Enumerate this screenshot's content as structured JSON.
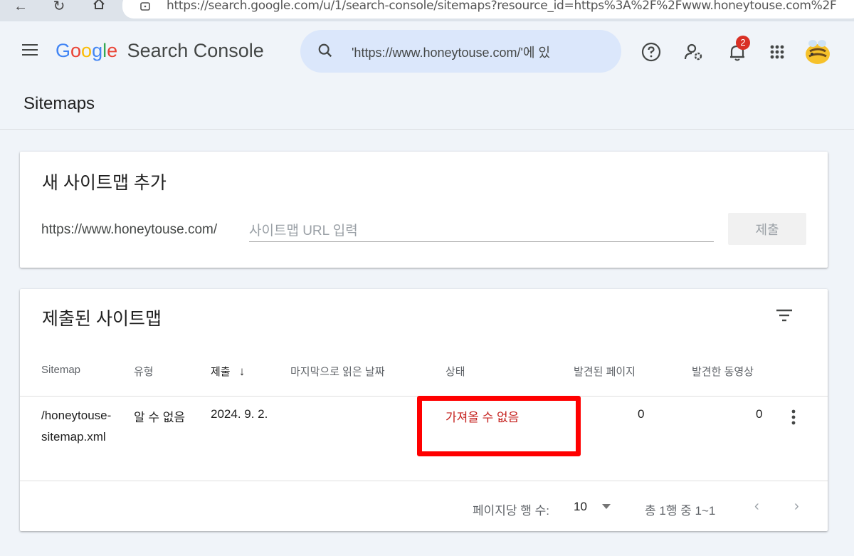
{
  "browser": {
    "url": "https://search.google.com/u/1/search-console/sitemaps?resource_id=https%3A%2F%2Fwww.honeytouse.com%2F"
  },
  "header": {
    "logo_letters": [
      "G",
      "o",
      "o",
      "g",
      "l",
      "e"
    ],
    "product_name": "Search Console",
    "search_value": "'https://www.honeytouse.com/'에 있",
    "notification_count": "2"
  },
  "page": {
    "title": "Sitemaps"
  },
  "add_sitemap": {
    "title": "새 사이트맵 추가",
    "url_prefix": "https://www.honeytouse.com/",
    "input_placeholder": "사이트맵 URL 입력",
    "submit_label": "제출"
  },
  "submitted": {
    "title": "제출된 사이트맵",
    "columns": [
      "Sitemap",
      "유형",
      "제출",
      "마지막으로 읽은 날짜",
      "상태",
      "발견된 페이지",
      "발견한 동영상"
    ],
    "sort_indicator": "↓",
    "rows": [
      {
        "sitemap": "/honeytouse-sitemap.xml",
        "type": "알 수 없음",
        "submitted": "2024. 9. 2.",
        "last_read": "",
        "status": "가져올 수 없음",
        "pages": "0",
        "videos": "0"
      }
    ],
    "pager": {
      "rows_per_page_label": "페이지당 행 수:",
      "rows_per_page": "10",
      "range": "총 1행 중 1~1"
    }
  },
  "colors": {
    "status_error": "#c5221f",
    "highlight_box": "#ff0000",
    "search_bg": "#dbe7fb"
  }
}
